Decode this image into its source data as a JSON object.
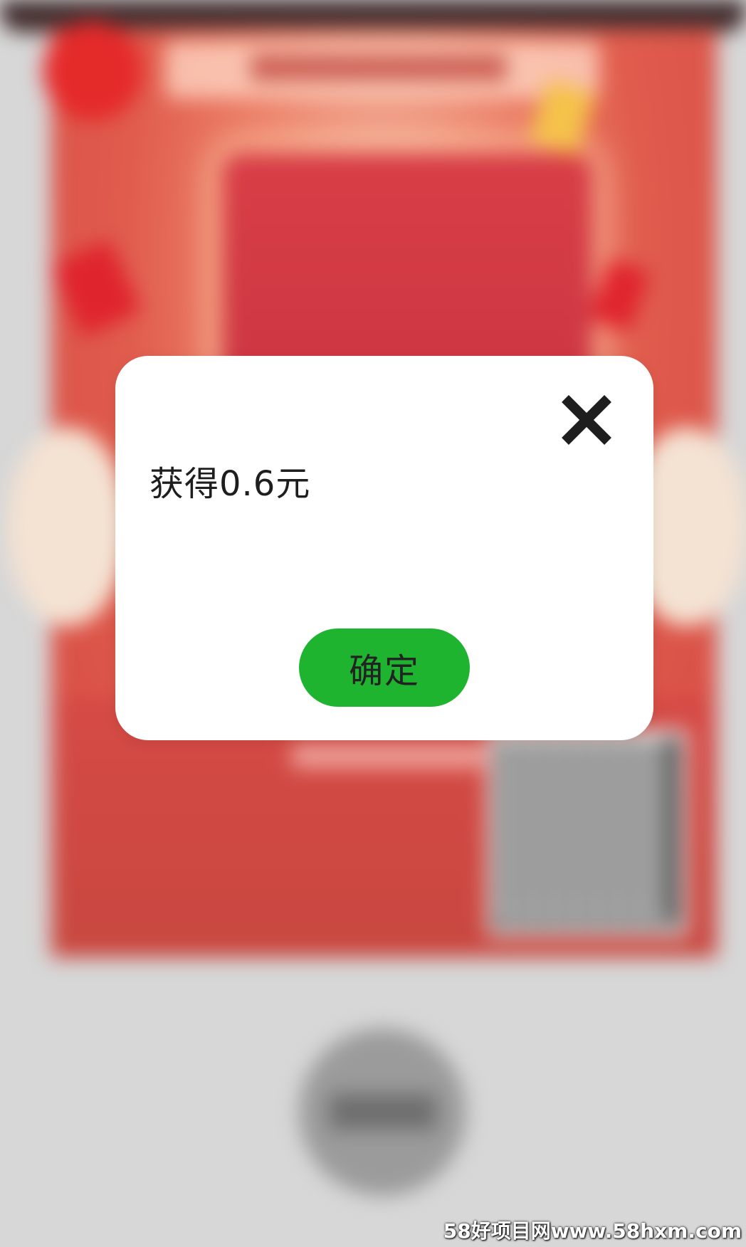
{
  "dialog": {
    "message": "获得0.6元",
    "confirm_label": "确定",
    "close_icon": "close-icon"
  },
  "watermark": {
    "text": "58好项目网www.58hxm.com"
  },
  "colors": {
    "confirm_button": "#1fb42f",
    "dialog_background": "#ffffff",
    "backdrop": "#d7d7d7",
    "poster_red": "#d54a43"
  }
}
